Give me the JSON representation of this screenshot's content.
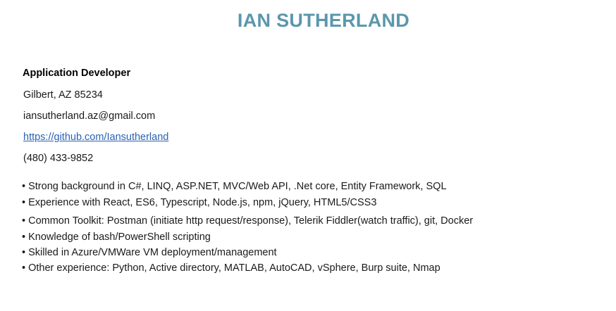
{
  "header": {
    "name": "IAN SUTHERLAND"
  },
  "contact": {
    "title": "Application Developer",
    "location": "Gilbert, AZ 85234",
    "email": "iansutherland.az@gmail.com",
    "github": "https://github.com/Iansutherland",
    "phone": "(480) 433-9852"
  },
  "skills": [
    "• Strong background in C#, LINQ, ASP.NET, MVC/Web API, .Net core, Entity Framework, SQL",
    "• Experience with React, ES6, Typescript, Node.js, npm, jQuery, HTML5/CSS3",
    "• Common Toolkit: Postman (initiate http request/response), Telerik Fiddler(watch traffic), git, Docker",
    "• Knowledge of bash/PowerShell scripting",
    "• Skilled in Azure/VMWare VM deployment/management",
    "• Other experience: Python, Active directory, MATLAB, AutoCAD, vSphere, Burp suite, Nmap"
  ],
  "colors": {
    "name": "#5b97ac",
    "link": "#2a62b3"
  }
}
